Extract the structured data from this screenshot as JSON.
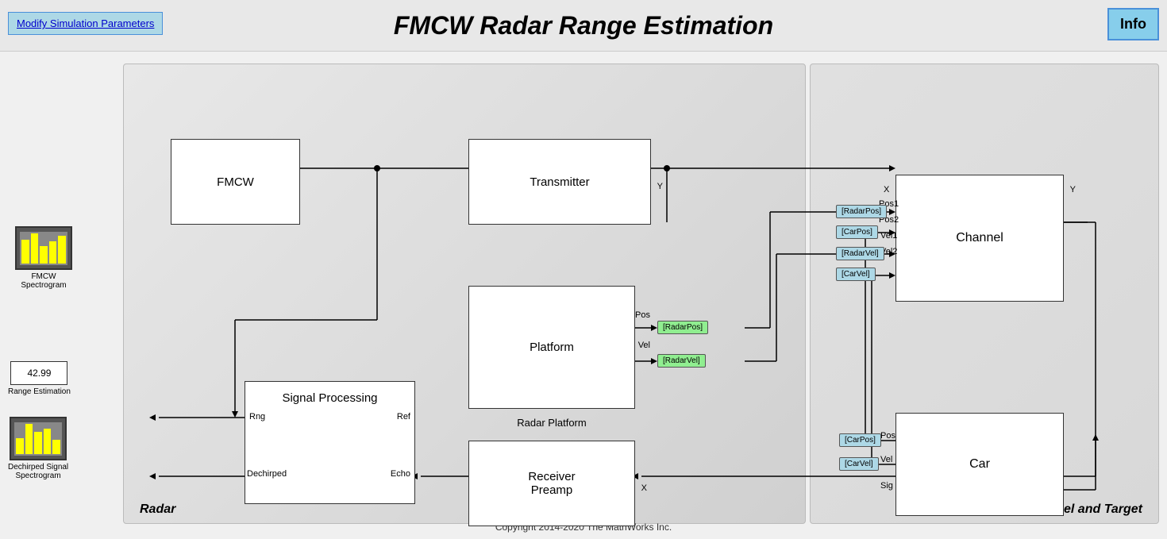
{
  "header": {
    "title": "FMCW Radar Range Estimation",
    "modify_btn": "Modify Simulation Parameters",
    "info_btn": "Info"
  },
  "blocks": {
    "fmcw": "FMCW",
    "transmitter": "Transmitter",
    "channel": "Channel",
    "platform": "Platform",
    "signal_processing": "Signal Processing",
    "receiver_preamp": "Receiver\nPreamp",
    "car": "Car"
  },
  "section_labels": {
    "radar": "Radar",
    "channel_target": "Channel and Target"
  },
  "signal_tags": {
    "radar_pos_out1": "[RadarPos]",
    "radar_pos_out2": "[RadarPos]",
    "car_pos_out": "[CarPos]",
    "radar_vel_out1": "[RadarVel]",
    "radar_vel_out2": "[RadarVel]",
    "car_vel_out": "[CarVel]",
    "car_pos_in": "[CarPos]",
    "car_vel_in": "[CarVel]"
  },
  "port_labels": {
    "transmitter_y": "Y",
    "channel_x": "X",
    "channel_pos1": "Pos1",
    "channel_pos2": "Pos2",
    "channel_vel1": "Vel1",
    "channel_vel2": "Vel2",
    "channel_y": "Y",
    "platform_pos": "Pos",
    "platform_vel": "Vel",
    "signal_rng": "Rng",
    "signal_ref": "Ref",
    "signal_dechirped": "Dechirped",
    "signal_echo": "Echo",
    "receiver_x": "X",
    "car_pos": "Pos",
    "car_vel": "Vel",
    "car_sig": "Sig"
  },
  "sub_labels": {
    "radar_platform": "Radar Platform",
    "fmcw_spectrogram": "FMCW Spectrogram",
    "range_estimation": "Range Estimation",
    "dechirped_signal": "Dechirped Signal\nSpectrogram"
  },
  "range_value": "42.99",
  "copyright": "Copyright 2014-2020 The MathWorks Inc."
}
